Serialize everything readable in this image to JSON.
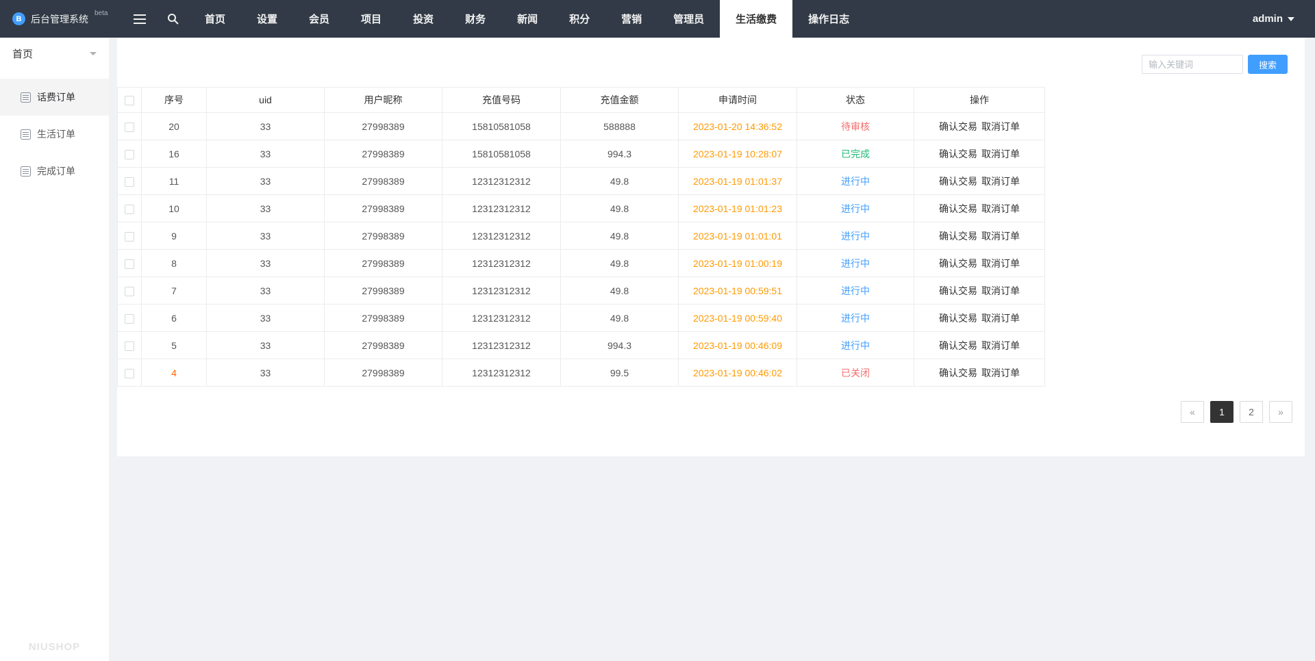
{
  "navbar": {
    "brand": "后台管理系统",
    "brand_badge": "beta",
    "items": [
      {
        "key": "home",
        "label": "首页",
        "active": false
      },
      {
        "key": "settings",
        "label": "设置",
        "active": false
      },
      {
        "key": "members",
        "label": "会员",
        "active": false
      },
      {
        "key": "projects",
        "label": "项目",
        "active": false
      },
      {
        "key": "invest",
        "label": "投资",
        "active": false
      },
      {
        "key": "finance",
        "label": "财务",
        "active": false
      },
      {
        "key": "news",
        "label": "新闻",
        "active": false
      },
      {
        "key": "points",
        "label": "积分",
        "active": false
      },
      {
        "key": "marketing",
        "label": "营销",
        "active": false
      },
      {
        "key": "admins",
        "label": "管理员",
        "active": false
      },
      {
        "key": "life-payment",
        "label": "生活缴费",
        "active": true
      },
      {
        "key": "operation-log",
        "label": "操作日志",
        "active": false
      }
    ],
    "user": "admin"
  },
  "sidebar": {
    "header": "首页",
    "items": [
      {
        "key": "phone-orders",
        "label": "话费订单",
        "active": true
      },
      {
        "key": "life-orders",
        "label": "生活订单",
        "active": false
      },
      {
        "key": "completed-orders",
        "label": "完成订单",
        "active": false
      }
    ],
    "footer_logo": "NIUSHOP"
  },
  "search": {
    "placeholder": "输入关键词",
    "button": "搜索"
  },
  "table": {
    "columns": [
      "序号",
      "uid",
      "用户昵称",
      "充值号码",
      "充值金额",
      "申请时间",
      "状态",
      "操作"
    ],
    "action_labels": [
      "确认交易",
      "取消订单"
    ],
    "rows": [
      {
        "seq": "20",
        "uid": "33",
        "nickname": "27998389",
        "number": "15810581058",
        "amount": "588888",
        "time": "2023-01-20 14:36:52",
        "status": "待审核",
        "status_type": "pending",
        "seq_highlight": false
      },
      {
        "seq": "16",
        "uid": "33",
        "nickname": "27998389",
        "number": "15810581058",
        "amount": "994.3",
        "time": "2023-01-19 10:28:07",
        "status": "已完成",
        "status_type": "done",
        "seq_highlight": false
      },
      {
        "seq": "11",
        "uid": "33",
        "nickname": "27998389",
        "number": "12312312312",
        "amount": "49.8",
        "time": "2023-01-19 01:01:37",
        "status": "进行中",
        "status_type": "progress",
        "seq_highlight": false
      },
      {
        "seq": "10",
        "uid": "33",
        "nickname": "27998389",
        "number": "12312312312",
        "amount": "49.8",
        "time": "2023-01-19 01:01:23",
        "status": "进行中",
        "status_type": "progress",
        "seq_highlight": false
      },
      {
        "seq": "9",
        "uid": "33",
        "nickname": "27998389",
        "number": "12312312312",
        "amount": "49.8",
        "time": "2023-01-19 01:01:01",
        "status": "进行中",
        "status_type": "progress",
        "seq_highlight": false
      },
      {
        "seq": "8",
        "uid": "33",
        "nickname": "27998389",
        "number": "12312312312",
        "amount": "49.8",
        "time": "2023-01-19 01:00:19",
        "status": "进行中",
        "status_type": "progress",
        "seq_highlight": false
      },
      {
        "seq": "7",
        "uid": "33",
        "nickname": "27998389",
        "number": "12312312312",
        "amount": "49.8",
        "time": "2023-01-19 00:59:51",
        "status": "进行中",
        "status_type": "progress",
        "seq_highlight": false
      },
      {
        "seq": "6",
        "uid": "33",
        "nickname": "27998389",
        "number": "12312312312",
        "amount": "49.8",
        "time": "2023-01-19 00:59:40",
        "status": "进行中",
        "status_type": "progress",
        "seq_highlight": false
      },
      {
        "seq": "5",
        "uid": "33",
        "nickname": "27998389",
        "number": "12312312312",
        "amount": "994.3",
        "time": "2023-01-19 00:46:09",
        "status": "进行中",
        "status_type": "progress",
        "seq_highlight": false
      },
      {
        "seq": "4",
        "uid": "33",
        "nickname": "27998389",
        "number": "12312312312",
        "amount": "99.5",
        "time": "2023-01-19 00:46:02",
        "status": "已关闭",
        "status_type": "closed",
        "seq_highlight": true
      }
    ]
  },
  "pagination": {
    "prev": "«",
    "pages": [
      "1",
      "2"
    ],
    "active": "1",
    "next": "»"
  },
  "colors": {
    "navbar_bg": "#313a46",
    "page_bg": "#f0f2f5",
    "accent": "#409eff",
    "time_color": "#ff9900",
    "status_pending": "#f56c6c",
    "status_done": "#1fba74",
    "status_progress": "#409eff",
    "status_closed": "#f56c6c",
    "seq_alert": "#ff6600"
  }
}
